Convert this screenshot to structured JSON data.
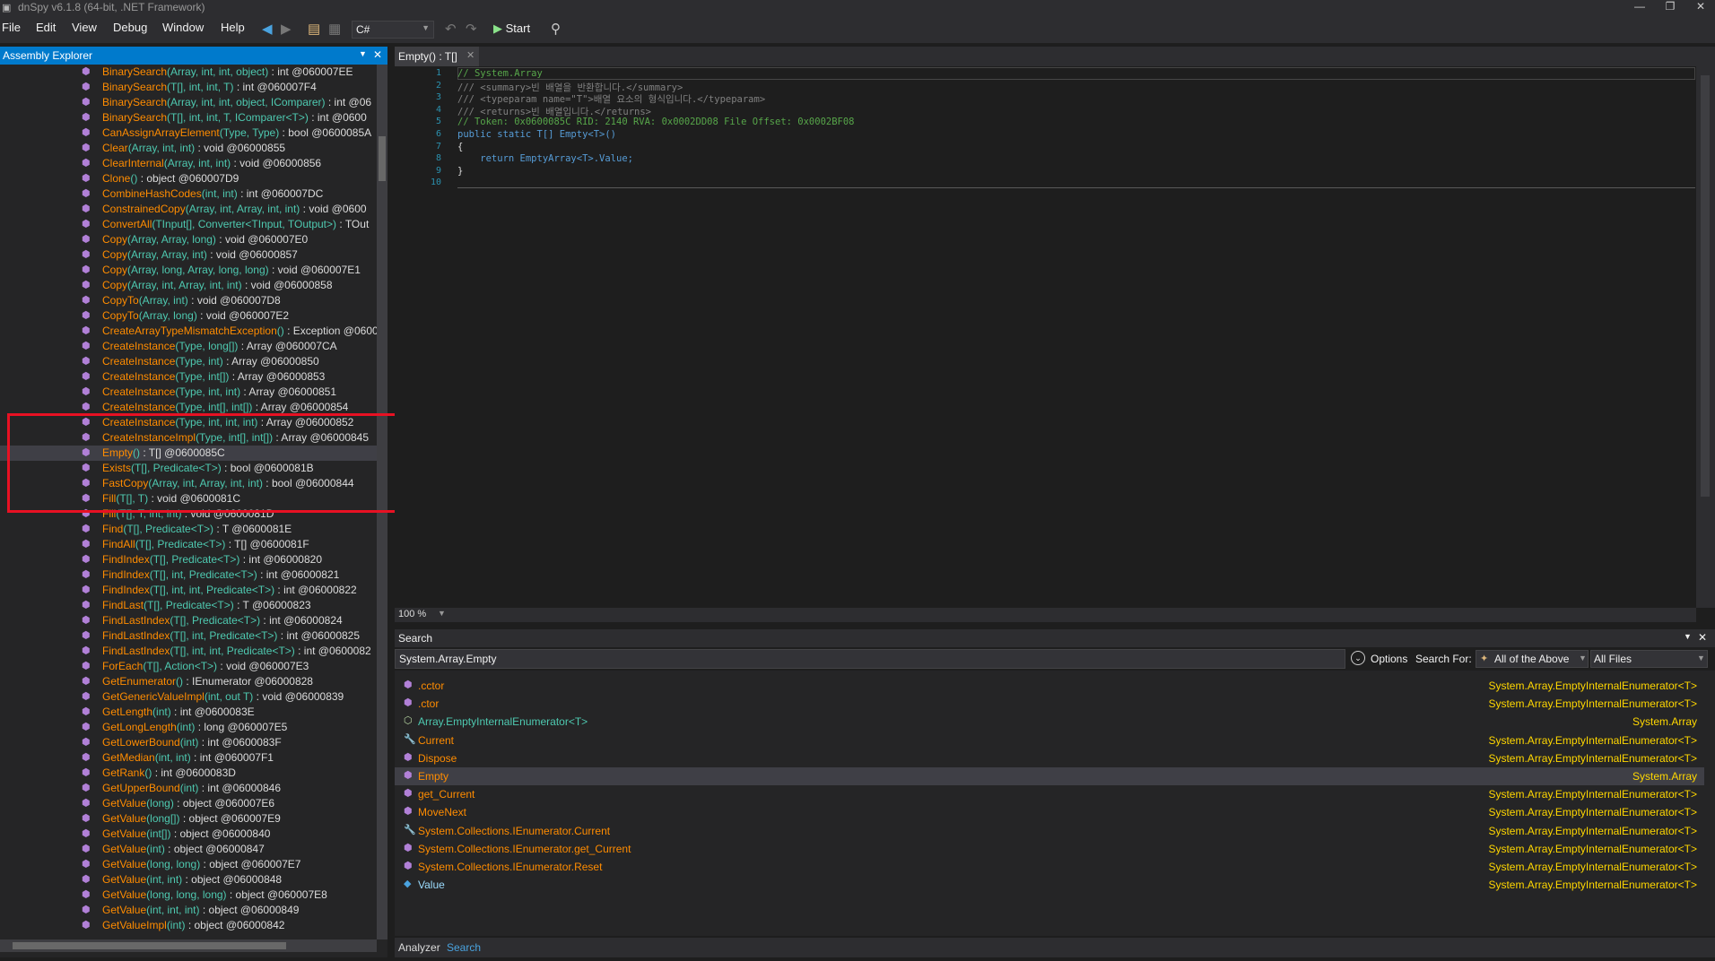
{
  "window": {
    "title": "dnSpy v6.1.8 (64-bit, .NET Framework)"
  },
  "menu": [
    "File",
    "Edit",
    "View",
    "Debug",
    "Window",
    "Help"
  ],
  "toolbar": {
    "language": "C#",
    "start_label": "Start"
  },
  "explorer": {
    "title": "Assembly Explorer",
    "rows": [
      {
        "name": "BinarySearch",
        "params": "(Array, int, int, object)",
        "ret": " : int @060007EE"
      },
      {
        "name": "BinarySearch",
        "params": "(T[], int, int, T)",
        "ret": " : int @060007F4"
      },
      {
        "name": "BinarySearch",
        "params": "(Array, int, int, object, IComparer)",
        "ret": " : int @06"
      },
      {
        "name": "BinarySearch",
        "params": "(T[], int, int, T, IComparer<T>)",
        "ret": " : int @0600"
      },
      {
        "name": "CanAssignArrayElement",
        "params": "(Type, Type)",
        "ret": " : bool @0600085A"
      },
      {
        "name": "Clear",
        "params": "(Array, int, int)",
        "ret": " : void @06000855"
      },
      {
        "name": "ClearInternal",
        "params": "(Array, int, int)",
        "ret": " : void @06000856"
      },
      {
        "name": "Clone",
        "params": "()",
        "ret": " : object @060007D9"
      },
      {
        "name": "CombineHashCodes",
        "params": "(int, int)",
        "ret": " : int @060007DC"
      },
      {
        "name": "ConstrainedCopy",
        "params": "(Array, int, Array, int, int)",
        "ret": " : void @0600"
      },
      {
        "name": "ConvertAll",
        "params": "(TInput[], Converter<TInput, TOutput>)",
        "ret": " : TOut"
      },
      {
        "name": "Copy",
        "params": "(Array, Array, long)",
        "ret": " : void @060007E0"
      },
      {
        "name": "Copy",
        "params": "(Array, Array, int)",
        "ret": " : void @06000857"
      },
      {
        "name": "Copy",
        "params": "(Array, long, Array, long, long)",
        "ret": " : void @060007E1"
      },
      {
        "name": "Copy",
        "params": "(Array, int, Array, int, int)",
        "ret": " : void @06000858"
      },
      {
        "name": "CopyTo",
        "params": "(Array, int)",
        "ret": " : void @060007D8"
      },
      {
        "name": "CopyTo",
        "params": "(Array, long)",
        "ret": " : void @060007E2"
      },
      {
        "name": "CreateArrayTypeMismatchException",
        "params": "()",
        "ret": " : Exception @0600"
      },
      {
        "name": "CreateInstance",
        "params": "(Type, long[])",
        "ret": " : Array @060007CA"
      },
      {
        "name": "CreateInstance",
        "params": "(Type, int)",
        "ret": " : Array @06000850"
      },
      {
        "name": "CreateInstance",
        "params": "(Type, int[])",
        "ret": " : Array @06000853"
      },
      {
        "name": "CreateInstance",
        "params": "(Type, int, int)",
        "ret": " : Array @06000851"
      },
      {
        "name": "CreateInstance",
        "params": "(Type, int[], int[])",
        "ret": " : Array @06000854"
      },
      {
        "name": "CreateInstance",
        "params": "(Type, int, int, int)",
        "ret": " : Array @06000852"
      },
      {
        "name": "CreateInstanceImpl",
        "params": "(Type, int[], int[])",
        "ret": " : Array @06000845"
      },
      {
        "name": "Empty",
        "params": "()",
        "ret": " : T[] @0600085C"
      },
      {
        "name": "Exists",
        "params": "(T[], Predicate<T>)",
        "ret": " : bool @0600081B"
      },
      {
        "name": "FastCopy",
        "params": "(Array, int, Array, int, int)",
        "ret": " : bool @06000844"
      },
      {
        "name": "Fill",
        "params": "(T[], T)",
        "ret": " : void @0600081C"
      },
      {
        "name": "Fill",
        "params": "(T[], T, int, int)",
        "ret": " : void @0600081D"
      },
      {
        "name": "Find",
        "params": "(T[], Predicate<T>)",
        "ret": " : T @0600081E"
      },
      {
        "name": "FindAll",
        "params": "(T[], Predicate<T>)",
        "ret": " : T[] @0600081F"
      },
      {
        "name": "FindIndex",
        "params": "(T[], Predicate<T>)",
        "ret": " : int @06000820"
      },
      {
        "name": "FindIndex",
        "params": "(T[], int, Predicate<T>)",
        "ret": " : int @06000821"
      },
      {
        "name": "FindIndex",
        "params": "(T[], int, int, Predicate<T>)",
        "ret": " : int @06000822"
      },
      {
        "name": "FindLast",
        "params": "(T[], Predicate<T>)",
        "ret": " : T @06000823"
      },
      {
        "name": "FindLastIndex",
        "params": "(T[], Predicate<T>)",
        "ret": " : int @06000824"
      },
      {
        "name": "FindLastIndex",
        "params": "(T[], int, Predicate<T>)",
        "ret": " : int @06000825"
      },
      {
        "name": "FindLastIndex",
        "params": "(T[], int, int, Predicate<T>)",
        "ret": " : int @0600082"
      },
      {
        "name": "ForEach",
        "params": "(T[], Action<T>)",
        "ret": " : void @060007E3"
      },
      {
        "name": "GetEnumerator",
        "params": "()",
        "ret": " : IEnumerator @06000828"
      },
      {
        "name": "GetGenericValueImpl",
        "params": "(int, out T)",
        "ret": " : void @06000839"
      },
      {
        "name": "GetLength",
        "params": "(int)",
        "ret": " : int @0600083E"
      },
      {
        "name": "GetLongLength",
        "params": "(int)",
        "ret": " : long @060007E5"
      },
      {
        "name": "GetLowerBound",
        "params": "(int)",
        "ret": " : int @0600083F"
      },
      {
        "name": "GetMedian",
        "params": "(int, int)",
        "ret": " : int @060007F1"
      },
      {
        "name": "GetRank",
        "params": "()",
        "ret": " : int @0600083D"
      },
      {
        "name": "GetUpperBound",
        "params": "(int)",
        "ret": " : int @06000846"
      },
      {
        "name": "GetValue",
        "params": "(long)",
        "ret": " : object @060007E6"
      },
      {
        "name": "GetValue",
        "params": "(long[])",
        "ret": " : object @060007E9"
      },
      {
        "name": "GetValue",
        "params": "(int[])",
        "ret": " : object @06000840"
      },
      {
        "name": "GetValue",
        "params": "(int)",
        "ret": " : object @06000847"
      },
      {
        "name": "GetValue",
        "params": "(long, long)",
        "ret": " : object @060007E7"
      },
      {
        "name": "GetValue",
        "params": "(int, int)",
        "ret": " : object @06000848"
      },
      {
        "name": "GetValue",
        "params": "(long, long, long)",
        "ret": " : object @060007E8"
      },
      {
        "name": "GetValue",
        "params": "(int, int, int)",
        "ret": " : object @06000849"
      },
      {
        "name": "GetValueImpl",
        "params": "(int)",
        "ret": " : object @06000842"
      }
    ],
    "selected_index": 25
  },
  "editor": {
    "tab_label": "Empty() : T[]",
    "lines": [
      "// System.Array",
      "/// <summary>빈 배열을 반환합니다.</summary>",
      "/// <typeparam name=\"T\">배열 요소의 형식입니다.</typeparam>",
      "/// <returns>빈 배열입니다.</returns>",
      "// Token: 0x0600085C RID: 2140 RVA: 0x0002DD08 File Offset: 0x0002BF08",
      "public static T[] Empty<T>()",
      "{",
      "    return EmptyArray<T>.Value;",
      "}",
      ""
    ],
    "zoom": "100 %"
  },
  "search": {
    "title": "Search",
    "query": "System.Array.Empty",
    "options_label": "Options",
    "search_for_label": "Search For:",
    "search_for_value": "All of the Above",
    "scope_value": "All Files",
    "results": [
      {
        "name": ".cctor",
        "parent": "System.Array.EmptyInternalEnumerator<T>",
        "icon": "method-icon"
      },
      {
        "name": ".ctor",
        "parent": "System.Array.EmptyInternalEnumerator<T>",
        "icon": "method-icon"
      },
      {
        "name": "Array.EmptyInternalEnumerator<T>",
        "parent": "System.Array",
        "icon": "class-icon"
      },
      {
        "name": "Current",
        "parent": "System.Array.EmptyInternalEnumerator<T>",
        "icon": "property-icon"
      },
      {
        "name": "Dispose",
        "parent": "System.Array.EmptyInternalEnumerator<T>",
        "icon": "method-icon"
      },
      {
        "name": "Empty",
        "parent": "System.Array",
        "icon": "method-icon"
      },
      {
        "name": "get_Current",
        "parent": "System.Array.EmptyInternalEnumerator<T>",
        "icon": "method-icon"
      },
      {
        "name": "MoveNext",
        "parent": "System.Array.EmptyInternalEnumerator<T>",
        "icon": "method-icon"
      },
      {
        "name": "System.Collections.IEnumerator.Current",
        "parent": "System.Array.EmptyInternalEnumerator<T>",
        "icon": "property-icon"
      },
      {
        "name": "System.Collections.IEnumerator.get_Current",
        "parent": "System.Array.EmptyInternalEnumerator<T>",
        "icon": "method-icon"
      },
      {
        "name": "System.Collections.IEnumerator.Reset",
        "parent": "System.Array.EmptyInternalEnumerator<T>",
        "icon": "method-icon"
      },
      {
        "name": "Value",
        "parent": "System.Array.EmptyInternalEnumerator<T>",
        "icon": "field-icon"
      }
    ],
    "selected_index": 5
  },
  "bottom_tabs": [
    "Analyzer",
    "Search"
  ]
}
